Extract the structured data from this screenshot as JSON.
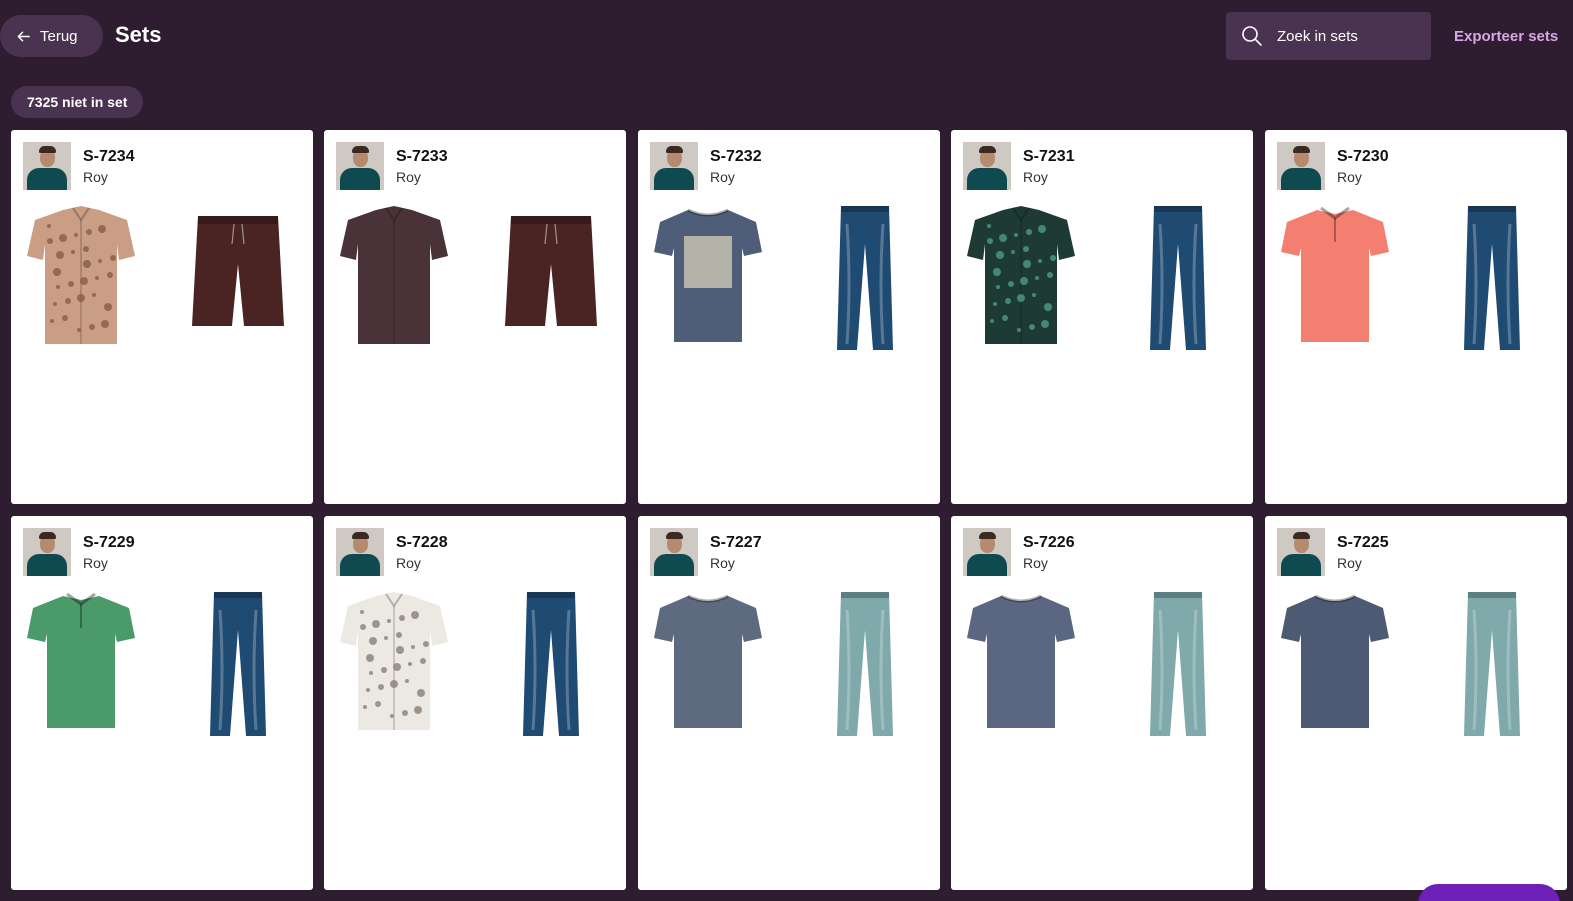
{
  "header": {
    "back_label": "Terug",
    "title": "Sets",
    "search_placeholder": "Zoek in sets",
    "export_label": "Exporteer sets"
  },
  "filter_chip": "7325 niet in set",
  "sets": [
    {
      "id": "S-7234",
      "owner": "Roy",
      "top": {
        "type": "shirt",
        "color": "#c99e85",
        "pattern": "#8a5b45"
      },
      "bottom": {
        "type": "shorts",
        "color": "#4a2323"
      }
    },
    {
      "id": "S-7233",
      "owner": "Roy",
      "top": {
        "type": "shirt",
        "color": "#4a3338",
        "pattern": ""
      },
      "bottom": {
        "type": "shorts",
        "color": "#4a2323"
      }
    },
    {
      "id": "S-7232",
      "owner": "Roy",
      "top": {
        "type": "tshirt",
        "color": "#4f5e78",
        "print": "#c7c1b3"
      },
      "bottom": {
        "type": "jeans",
        "color": "#1f4a72"
      }
    },
    {
      "id": "S-7231",
      "owner": "Roy",
      "top": {
        "type": "shirt",
        "color": "#1d3b34",
        "pattern": "#4e9c84"
      },
      "bottom": {
        "type": "jeans",
        "color": "#1f4a72"
      }
    },
    {
      "id": "S-7230",
      "owner": "Roy",
      "top": {
        "type": "polo",
        "color": "#f47f70"
      },
      "bottom": {
        "type": "jeans",
        "color": "#1f4a72"
      }
    },
    {
      "id": "S-7229",
      "owner": "Roy",
      "top": {
        "type": "polo",
        "color": "#4a9a6a"
      },
      "bottom": {
        "type": "jeans",
        "color": "#1f4a72"
      }
    },
    {
      "id": "S-7228",
      "owner": "Roy",
      "top": {
        "type": "shirt",
        "color": "#ece8e2",
        "pattern": "#8a8078"
      },
      "bottom": {
        "type": "jeans",
        "color": "#1f4a72"
      }
    },
    {
      "id": "S-7227",
      "owner": "Roy",
      "top": {
        "type": "tshirt",
        "color": "#5d6a80"
      },
      "bottom": {
        "type": "jeans",
        "color": "#7fa9aa"
      }
    },
    {
      "id": "S-7226",
      "owner": "Roy",
      "top": {
        "type": "tshirt",
        "color": "#5b6781"
      },
      "bottom": {
        "type": "jeans",
        "color": "#7fa9aa"
      }
    },
    {
      "id": "S-7225",
      "owner": "Roy",
      "top": {
        "type": "tshirt",
        "color": "#4d5a74"
      },
      "bottom": {
        "type": "jeans",
        "color": "#7fa9aa"
      }
    }
  ]
}
